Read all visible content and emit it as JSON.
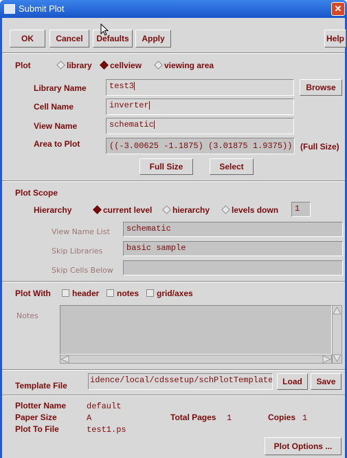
{
  "window": {
    "title": "Submit Plot",
    "close": "✕"
  },
  "toolbar": {
    "ok": "OK",
    "cancel": "Cancel",
    "defaults": "Defaults",
    "apply": "Apply",
    "help": "Help"
  },
  "plot": {
    "label": "Plot",
    "options": [
      "library",
      "cellview",
      "viewing area"
    ],
    "selected": "cellview",
    "library_name_label": "Library Name",
    "library_name": "test3",
    "browse": "Browse",
    "cell_name_label": "Cell Name",
    "cell_name": "inverter",
    "view_name_label": "View Name",
    "view_name": "schematic",
    "area_label": "Area to Plot",
    "area": "((-3.00625 -1.1875) (3.01875 1.9375))",
    "area_note": "(Full Size)",
    "full_size": "Full Size",
    "select": "Select"
  },
  "scope": {
    "label": "Plot Scope",
    "hierarchy_label": "Hierarchy",
    "options": [
      "current level",
      "hierarchy",
      "levels down"
    ],
    "selected": "current level",
    "levels": "1",
    "view_list_label": "View Name List",
    "view_list": "schematic",
    "skip_libs_label": "Skip Libraries",
    "skip_libs": "basic sample",
    "skip_cells_label": "Skip Cells Below",
    "skip_cells": ""
  },
  "plotwith": {
    "label": "Plot With",
    "options": [
      "header",
      "notes",
      "grid/axes"
    ],
    "notes_label": "Notes"
  },
  "template": {
    "label": "Template File",
    "value": "idence/local/cdssetup/schPlotTemplate",
    "load": "Load",
    "save": "Save"
  },
  "info": {
    "plotter_label": "Plotter Name",
    "plotter": "default",
    "paper_label": "Paper Size",
    "paper": "A",
    "pages_label": "Total Pages",
    "pages": "1",
    "copies_label": "Copies",
    "copies": "1",
    "file_label": "Plot To File",
    "file": "test1.ps",
    "options_btn": "Plot Options ..."
  }
}
